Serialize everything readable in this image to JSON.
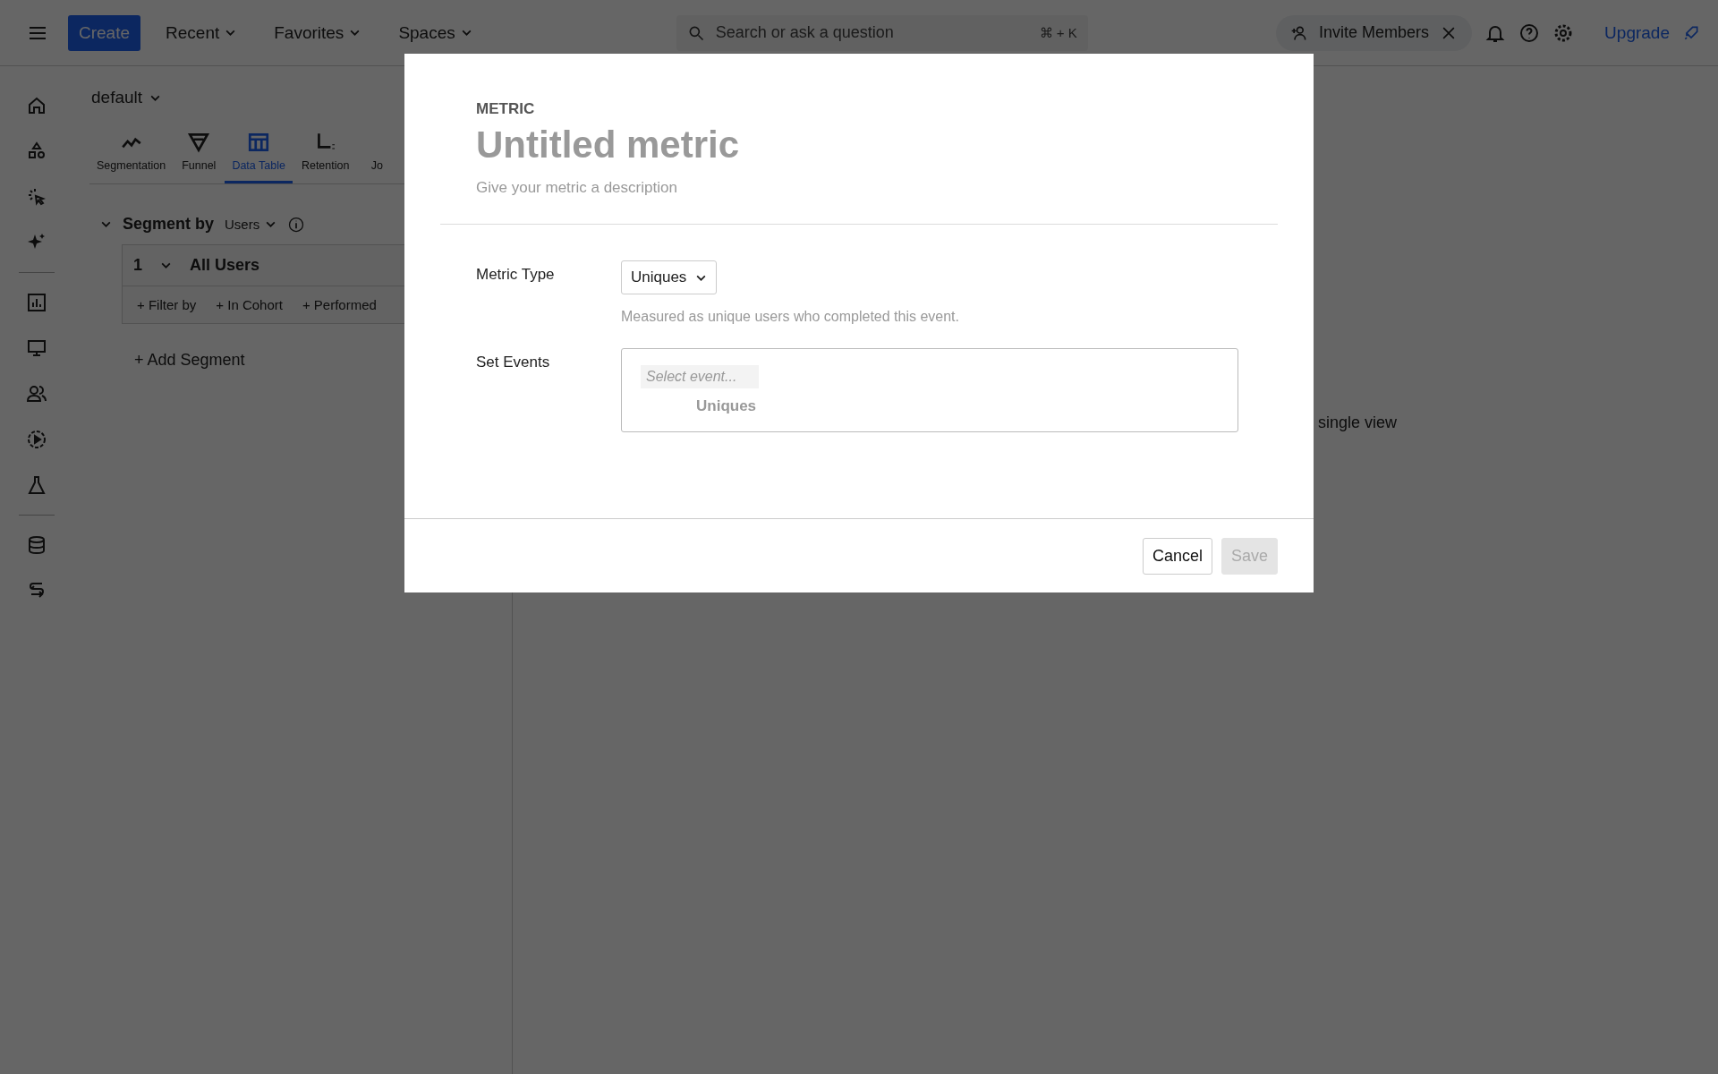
{
  "top_bar": {
    "create": "Create",
    "menus": [
      {
        "label": "Recent"
      },
      {
        "label": "Favorites"
      },
      {
        "label": "Spaces"
      }
    ],
    "search": {
      "placeholder": "Search or ask a question",
      "shortcut": "⌘ + K"
    },
    "invite": "Invite Members",
    "upgrade": "Upgrade"
  },
  "panel": {
    "project": "default",
    "tabs": [
      {
        "label": "Segmentation",
        "selected": false
      },
      {
        "label": "Funnel",
        "selected": false
      },
      {
        "label": "Data Table",
        "selected": true
      },
      {
        "label": "Retention",
        "selected": false
      },
      {
        "label": "Jo",
        "selected": false
      }
    ],
    "segment_by": {
      "label": "Segment by",
      "value": "Users"
    },
    "segment": {
      "index": "1",
      "name": "All Users",
      "filters": [
        "+ Filter by",
        "+ In Cohort",
        "+ Performed"
      ]
    },
    "add_segment": "+ Add Segment"
  },
  "main": {
    "hint": "single view"
  },
  "modal": {
    "eyebrow": "METRIC",
    "title": "Untitled metric",
    "description": {
      "placeholder": "Give your metric a description"
    },
    "metric_type": {
      "label": "Metric Type",
      "value": "Uniques",
      "help": "Measured as unique users who completed this event."
    },
    "set_events": {
      "label": "Set Events",
      "placeholder": "Select event...",
      "sub": "Uniques"
    },
    "buttons": [
      {
        "label": "Cancel",
        "disabled": false
      },
      {
        "label": "Save",
        "disabled": true
      }
    ]
  }
}
